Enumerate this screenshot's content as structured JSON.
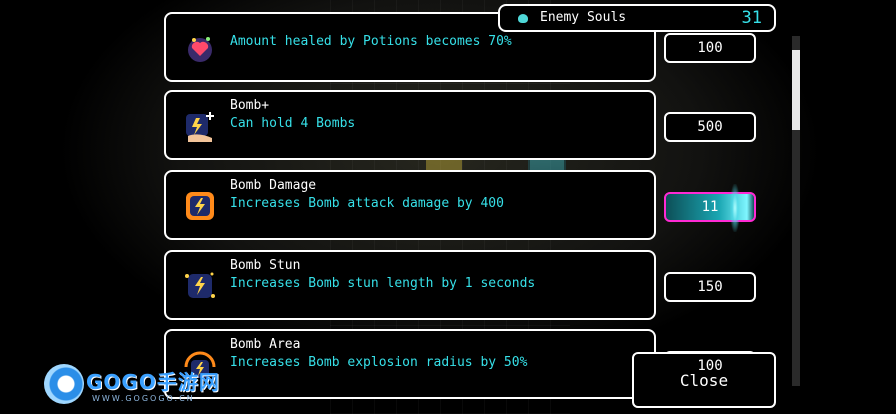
{
  "header": {
    "souls_label": "Enemy Souls",
    "souls_count": "31",
    "souls_icon": "soul-gem-icon"
  },
  "upgrades": [
    {
      "title": "",
      "description": "Amount healed by Potions becomes 70%",
      "cost": "100",
      "icon": "potion-heal-icon",
      "selected": false
    },
    {
      "title": "Bomb+",
      "description": "Can hold 4 Bombs",
      "cost": "500",
      "icon": "bomb-plus-icon",
      "selected": false
    },
    {
      "title": "Bomb Damage",
      "description": "Increases Bomb attack damage by 400",
      "cost": "11",
      "icon": "bomb-damage-icon",
      "selected": true
    },
    {
      "title": "Bomb Stun",
      "description": "Increases Bomb stun length by 1 seconds",
      "cost": "150",
      "icon": "bomb-stun-icon",
      "selected": false
    },
    {
      "title": "Bomb Area",
      "description": "Increases Bomb explosion radius by 50%",
      "cost": "100",
      "icon": "bomb-area-icon",
      "selected": false
    }
  ],
  "close_button": {
    "label": "Close"
  },
  "watermark": {
    "brand": "GOGO手游网",
    "url": "WWW.GOGOGO.CN"
  },
  "colors": {
    "accent": "#36e0e8",
    "selected_border": "#ff2ad4",
    "border": "#ffffff",
    "background": "#000000"
  }
}
